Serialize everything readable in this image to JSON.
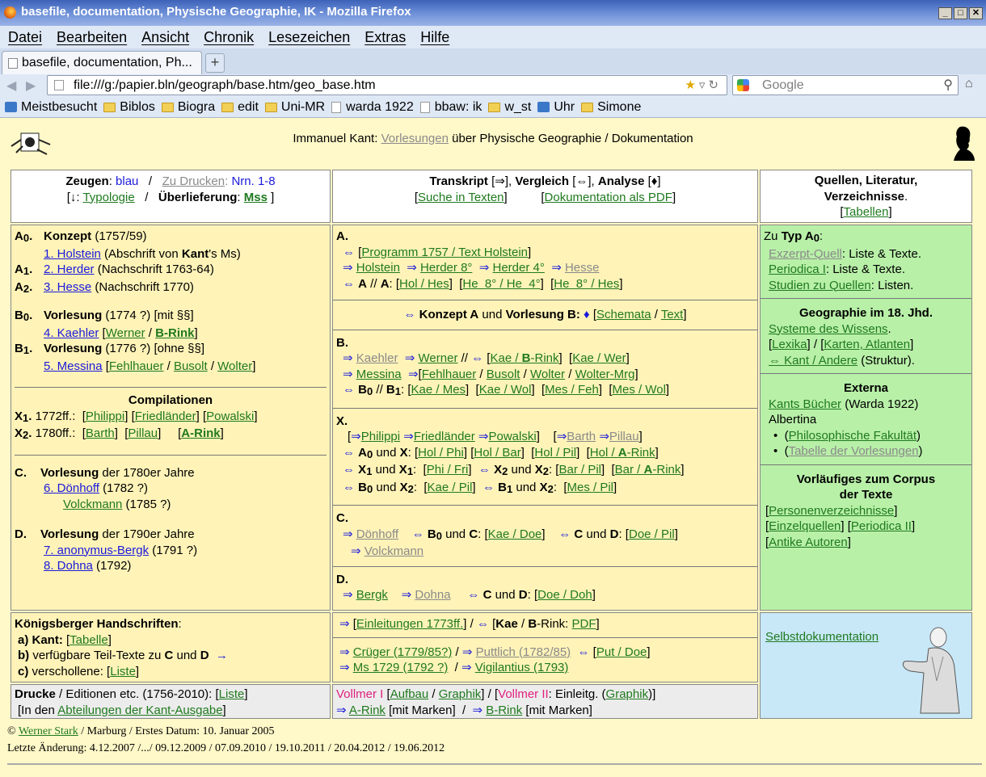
{
  "window": {
    "title": "basefile, documentation, Physische Geographie, IK - Mozilla Firefox"
  },
  "menu": [
    "Datei",
    "Bearbeiten",
    "Ansicht",
    "Chronik",
    "Lesezeichen",
    "Extras",
    "Hilfe"
  ],
  "tab": {
    "label": "basefile, documentation, Ph...",
    "new": "+"
  },
  "nav": {
    "url": "file:///g:/papier.bln/geograph/base.htm/geo_base.htm",
    "search_placeholder": "Google"
  },
  "bookmarks": [
    "Meistbesucht",
    "Biblos",
    "Biogra",
    "edit",
    "Uni-MR",
    "warda 1922",
    "bbaw: ik",
    "w_st",
    "Uhr",
    "Simone"
  ],
  "header": {
    "pre": "Immanuel Kant: ",
    "link": "Vorlesungen",
    "post": " über Physische Geographie / Dokumentation"
  },
  "top_left": {
    "zeugen": "Zeugen",
    "blau": "blau",
    "zu_drucken": "Zu Drucken",
    "nrn": "Nrn. 1-8",
    "typologie": "Typologie",
    "ueberlieferung": "Überlieferung",
    "mss": "Mss"
  },
  "top_mid": {
    "transkript": "Transkript",
    "vergleich": "Vergleich",
    "analyse": "Analyse",
    "suche": "Suche in Texten",
    "doku": "Dokumentation als PDF"
  },
  "top_right": {
    "title": "Quellen, Literatur, Verzeichnisse",
    "tabellen": "Tabellen"
  },
  "left": {
    "a0": "A",
    "konzept": "Konzept",
    "konzept_date": " (1757/59)",
    "holstein": "1. Holstein",
    "holstein_note": " (Abschrift von ",
    "kant": "Kant",
    "kant_note": "'s Ms)",
    "herder": "2. Herder",
    "herder_note": " (Nachschrift 1763-64)",
    "hesse": "3. Hesse",
    "hesse_note": " (Nachschrift 1770)",
    "vorlesung": "Vorlesung",
    "v1_date": " (1774 ?) [mit §§]",
    "v2_date": " (1776 ?) [ohne §§]",
    "kaehler": "4. Kaehler",
    "werner": "Werner",
    "brink": "B-Rink",
    "messina": "5. Messina",
    "fehlhauer": "Fehlhauer",
    "busolt": "Busolt",
    "wolter": "Wolter",
    "compilationen": "Compilationen",
    "x1_date": " 1772ff.:",
    "philippi": "Philippi",
    "friedlaender": "Friedländer",
    "powalski": "Powalski",
    "x2_date": " 1780ff.:",
    "barth": "Barth",
    "pillau": "Pillau",
    "arink": "A-Rink",
    "c_label": "C.",
    "c_text": " der 1780er Jahre",
    "doenhoff": "6. Dönhoff",
    "doenhoff_date": " (1782 ?)",
    "volckmann": "Volckmann",
    "volckmann_date": " (1785 ?)",
    "d_label": "D.",
    "d_text": " der 1790er Jahre",
    "bergk": "7. anonymus-Bergk",
    "bergk_date": " (1791 ?)",
    "dohna": "8. Dohna",
    "dohna_date": " (1792)"
  },
  "right": {
    "zu_typ": "Zu ",
    "typ": "Typ A",
    "exzerpt": "Exzerpt-Quell",
    "exzerpt_note": ": Liste & Texte.",
    "periodica": "Periodica I",
    "periodica_note": ": Liste & Texte.",
    "studien": "Studien zu Quellen",
    "studien_note": ": Listen.",
    "geo_title": "Geographie im 18. Jhd.",
    "systeme": "Systeme des Wissens",
    "lexika": "Lexika",
    "karten": "Karten, Atlanten",
    "kant_andere": "Kant / Andere",
    "struktur": " (Struktur).",
    "externa": "Externa",
    "kants_buecher": "Kants Bücher",
    "warda": " (Warda 1922)",
    "albertina": "Albertina",
    "philfak": "Philosophische Fakultät",
    "tabelle_vorl": "Tabelle der Vorlesungen",
    "vorl_title": "Vorläufiges zum Corpus der Texte",
    "personen": "Personenverzeichnisse",
    "einzelquellen": "Einzelquellen",
    "periodica2": "Periodica II",
    "antike": "Antike Autoren"
  },
  "koenigsberg": {
    "title": "Königsberger Handschriften",
    "a": "a) Kant: ",
    "tabelle": "Tabelle",
    "b": "b) verfügbare Teil-Texte zu ",
    "c": "c) verschollene: ",
    "liste": "Liste"
  },
  "drucke": {
    "title": "Drucke",
    "text": " / Editionen etc. (1756-2010): ",
    "liste": "Liste",
    "line2": "[In den ",
    "abt": "Abteilungen der Kant-Ausgabe"
  },
  "mid_bottom": {
    "einleitungen": "Einleitungen 1773ff.",
    "kae_brink": "Kae",
    "pdf": "PDF",
    "crueger": "Crüger (1779/85?)",
    "puttlich": "Puttlich (1782/85)",
    "put_doe": "Put / Doe",
    "ms1729": "Ms 1729 (1792 ?)",
    "vigilantius": "Vigilantius (1793)"
  },
  "mid_last": {
    "vollmer1": "Vollmer I",
    "aufbau": "Aufbau",
    "graphik": "Graphik",
    "vollmer2": "Vollmer II",
    "einleitg": ": Einleitg. (",
    "arink": "A-Rink",
    "brink": "B-Rink",
    "marken": " [mit Marken]"
  },
  "selbst": "Selbstdokumentation",
  "footer": {
    "line1_author": "Werner Stark",
    "line1_rest": " / Marburg / Erstes Datum: 10. Januar 2005",
    "line2": "Letzte Änderung: 4.12.2007 /.../ 09.12.2009 / 07.09.2010 / 19.10.2011 / 20.04.2012 / 19.06.2012"
  }
}
